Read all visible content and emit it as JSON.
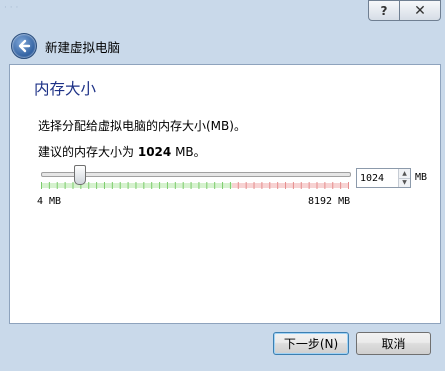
{
  "window": {
    "help_label": "?",
    "close_label": "✕"
  },
  "header": {
    "title": "新建虚拟电脑"
  },
  "page": {
    "heading": "内存大小",
    "description": "选择分配给虚拟电脑的内存大小(MB)。",
    "recommended_prefix": "建议的内存大小为",
    "recommended_value": "1024",
    "recommended_suffix": "MB。"
  },
  "memory": {
    "value": "1024",
    "unit": "MB",
    "min_label": "4 MB",
    "max_label": "8192 MB",
    "min": 4,
    "max": 8192,
    "safe_limit_fraction": 0.62
  },
  "buttons": {
    "next_label": "下一步(N)",
    "cancel_label": "取消"
  },
  "colors": {
    "heading": "#1e3287",
    "safe_ticks": "#7ccc6c",
    "warn_ticks": "#e58d8d"
  }
}
